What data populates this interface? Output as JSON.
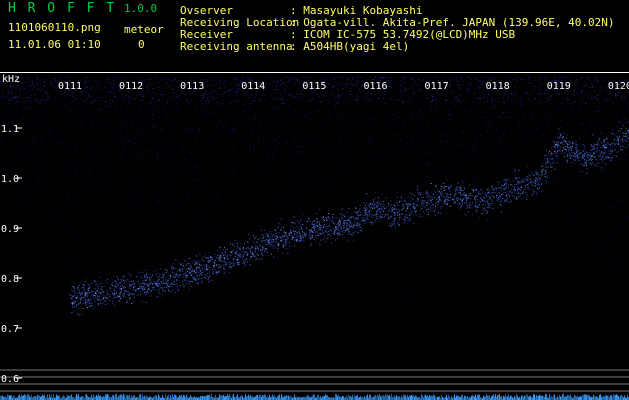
{
  "header": {
    "app_name": "H R O F F T",
    "version": "1.0.0",
    "filename": "1101060110.png",
    "meteor_label": "meteor",
    "datetime": "11.01.06 01:10",
    "meteor_count": "0",
    "info": [
      {
        "label": "Ovserver",
        "value": ": Masayuki Kobayashi"
      },
      {
        "label": "Receiving Location",
        "value": ": Ogata-vill. Akita-Pref. JAPAN (139.96E, 40.02N)"
      },
      {
        "label": "Receiver",
        "value": ": ICOM IC-575 53.7492(@LCD)MHz USB"
      },
      {
        "label": "Receiving antenna",
        "value": ": A504HB(yagi 4el)"
      }
    ]
  },
  "colors": {
    "background": "#000000",
    "app_name": "#00cc44",
    "text_yellow": "#ffff66",
    "signal": "#4a6cff",
    "noise": "#1a22aa",
    "axis": "#ffffff"
  },
  "chart_data": {
    "type": "scatter",
    "ylabel": "kHz",
    "ylim": [
      0.58,
      1.2
    ],
    "y_ticks": [
      "1.1",
      "1.0",
      "0.9",
      "0.8",
      "0.7",
      "0.6"
    ],
    "y_tick_values": [
      1.1,
      1.0,
      0.9,
      0.8,
      0.7,
      0.6
    ],
    "time_labels": [
      "0111",
      "0112",
      "0113",
      "0114",
      "0115",
      "0116",
      "0117",
      "0118",
      "0119",
      "0120"
    ],
    "series": [
      {
        "x": [
          0.0,
          1.0,
          1.4,
          2.0,
          2.6,
          3.0,
          3.4,
          4.0,
          4.6,
          5.0,
          5.3,
          5.8,
          6.2,
          6.8,
          7.0,
          7.2,
          7.6,
          8.0,
          8.4,
          8.8,
          9.0,
          9.3,
          9.6,
          10.0
        ],
        "y": [
          0.76,
          0.78,
          0.79,
          0.81,
          0.84,
          0.86,
          0.88,
          0.9,
          0.91,
          0.94,
          0.93,
          0.95,
          0.97,
          0.95,
          0.97,
          0.98,
          0.99,
          1.07,
          1.04,
          1.06,
          1.08,
          1.1,
          1.12,
          1.11
        ]
      }
    ]
  }
}
